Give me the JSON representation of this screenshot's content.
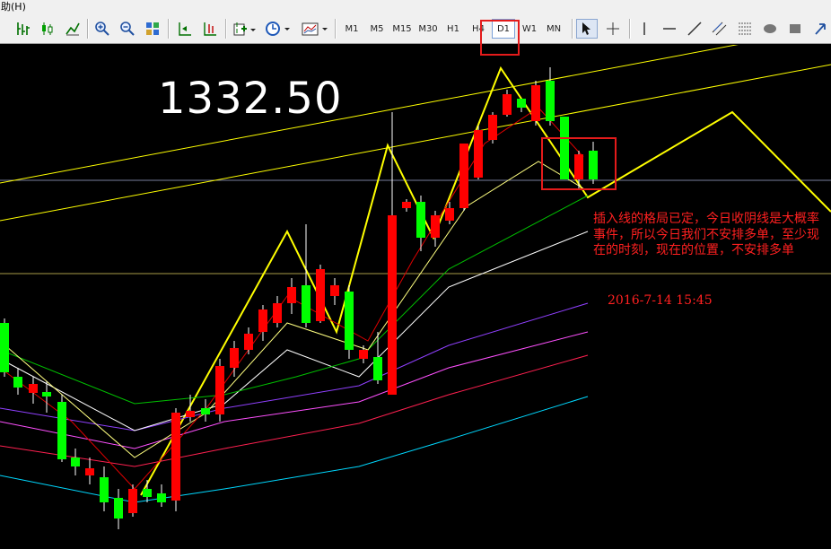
{
  "menu": {
    "help_label": "助(H)"
  },
  "toolbar": {
    "timeframes": [
      "M1",
      "M5",
      "M15",
      "M30",
      "H1",
      "H4",
      "D1",
      "W1",
      "MN"
    ],
    "selected_timeframe": "D1"
  },
  "chart": {
    "price_label": "1332.50",
    "annotation": "插入线的格局已定，今日收阴线是大概率事件，所以今日我们不安排多单，至少现在的时刻，现在的位置，不安排多单",
    "timestamp": "2016-7-14 15:45",
    "colors": {
      "background": "#000000",
      "bull_candle": "#ff0000",
      "bear_candle": "#00ff00",
      "trendline": "#ffff00",
      "annotation_text": "#ff2020",
      "highlight_box": "#e41b1b"
    }
  }
}
